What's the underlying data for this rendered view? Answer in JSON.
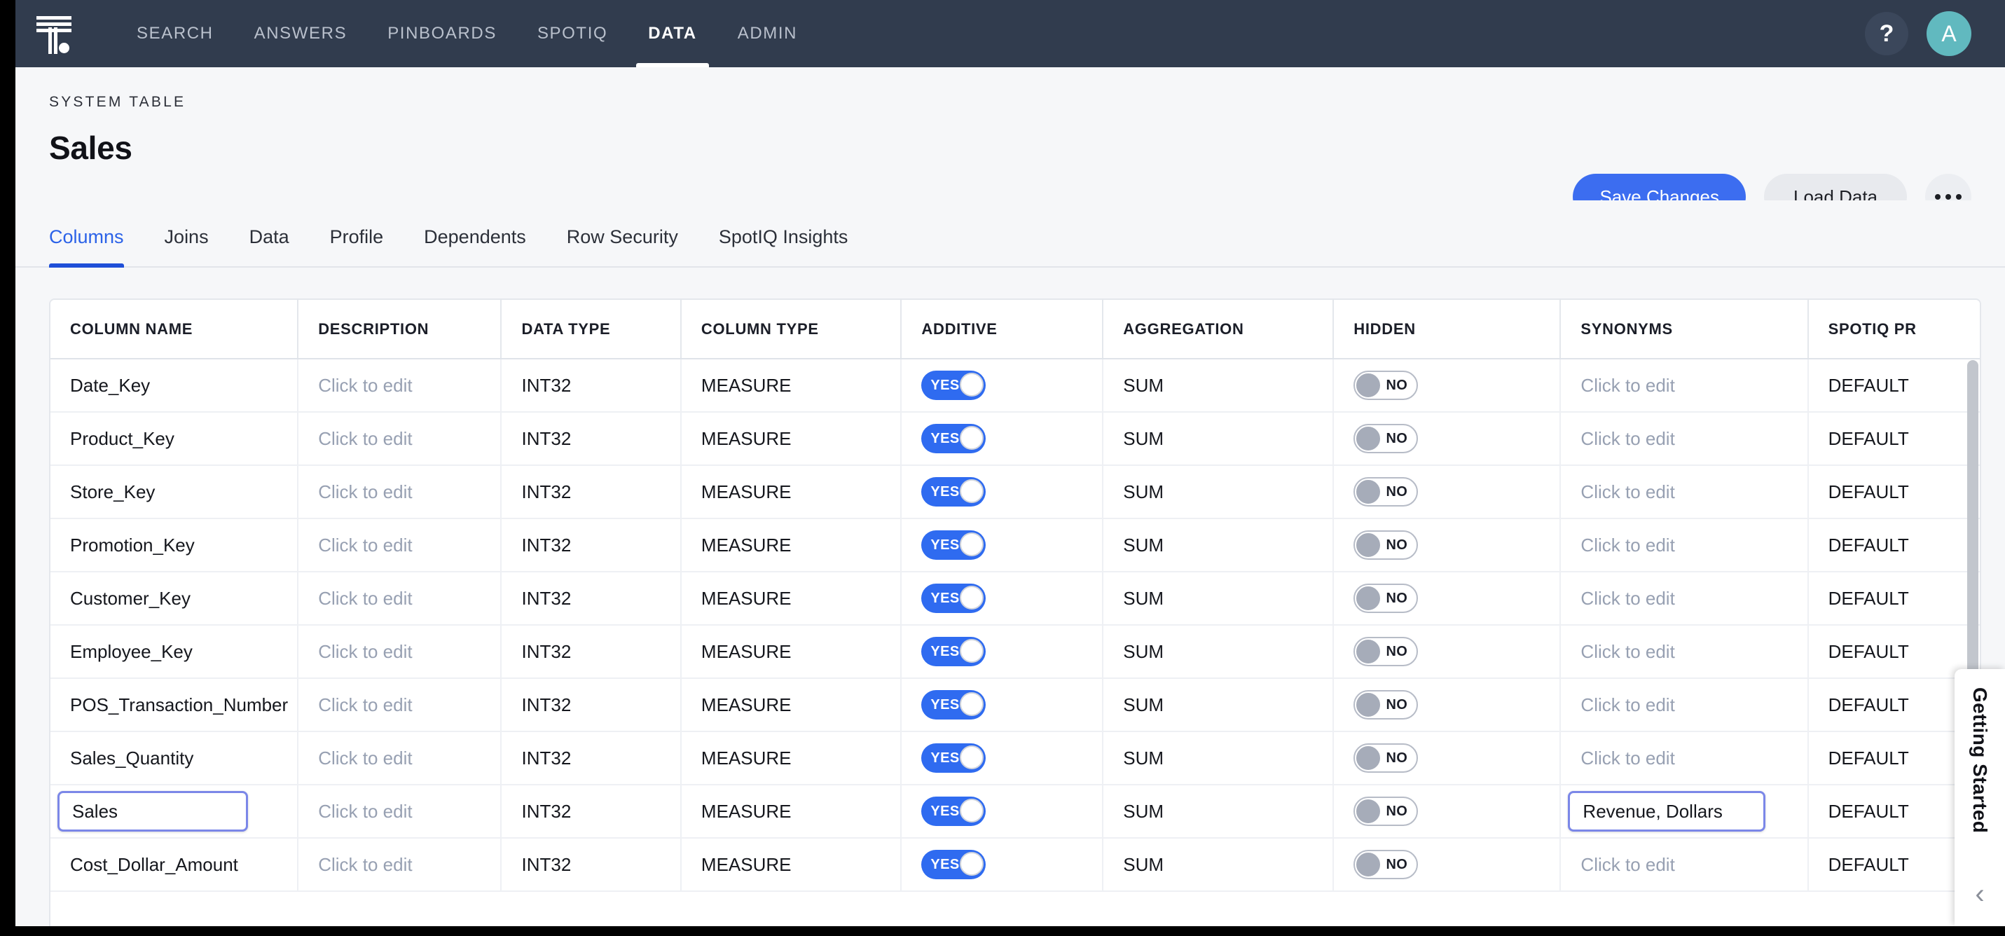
{
  "app": {
    "logo_icon": "thoughtspot-logo-icon",
    "nav_items": [
      {
        "label": "SEARCH",
        "active": false
      },
      {
        "label": "ANSWERS",
        "active": false
      },
      {
        "label": "PINBOARDS",
        "active": false
      },
      {
        "label": "SPOTIQ",
        "active": false
      },
      {
        "label": "DATA",
        "active": true
      },
      {
        "label": "ADMIN",
        "active": false
      }
    ],
    "help_glyph": "?",
    "help_icon": "help-question-icon",
    "avatar_initial": "A",
    "avatar_color": "#61b9bf",
    "nav_background": "#313c4e"
  },
  "page": {
    "eyebrow": "SYSTEM TABLE",
    "title": "Sales",
    "actions": {
      "save_label": "Save Changes",
      "load_label": "Load Data",
      "more_icon": "more-horizontal-icon"
    },
    "accent_color": "#3c6df0"
  },
  "tabs": [
    {
      "label": "Columns",
      "active": true
    },
    {
      "label": "Joins",
      "active": false
    },
    {
      "label": "Data",
      "active": false
    },
    {
      "label": "Profile",
      "active": false
    },
    {
      "label": "Dependents",
      "active": false
    },
    {
      "label": "Row Security",
      "active": false
    },
    {
      "label": "SpotIQ Insights",
      "active": false
    }
  ],
  "table": {
    "headers": [
      "COLUMN NAME",
      "DESCRIPTION",
      "DATA TYPE",
      "COLUMN TYPE",
      "ADDITIVE",
      "AGGREGATION",
      "HIDDEN",
      "SYNONYMS",
      "SPOTIQ PR"
    ],
    "description_placeholder": "Click to edit",
    "synonyms_placeholder": "Click to edit",
    "toggle_on_label": "YES",
    "toggle_off_label": "NO",
    "rows": [
      {
        "name": "Date_Key",
        "description": "Click to edit",
        "data_type": "INT32",
        "column_type": "MEASURE",
        "additive": "YES",
        "aggregation": "SUM",
        "hidden": "NO",
        "synonyms": "Click to edit",
        "spotiq": "DEFAULT",
        "name_editing": false,
        "synonyms_editing": false
      },
      {
        "name": "Product_Key",
        "description": "Click to edit",
        "data_type": "INT32",
        "column_type": "MEASURE",
        "additive": "YES",
        "aggregation": "SUM",
        "hidden": "NO",
        "synonyms": "Click to edit",
        "spotiq": "DEFAULT",
        "name_editing": false,
        "synonyms_editing": false
      },
      {
        "name": "Store_Key",
        "description": "Click to edit",
        "data_type": "INT32",
        "column_type": "MEASURE",
        "additive": "YES",
        "aggregation": "SUM",
        "hidden": "NO",
        "synonyms": "Click to edit",
        "spotiq": "DEFAULT",
        "name_editing": false,
        "synonyms_editing": false
      },
      {
        "name": "Promotion_Key",
        "description": "Click to edit",
        "data_type": "INT32",
        "column_type": "MEASURE",
        "additive": "YES",
        "aggregation": "SUM",
        "hidden": "NO",
        "synonyms": "Click to edit",
        "spotiq": "DEFAULT",
        "name_editing": false,
        "synonyms_editing": false
      },
      {
        "name": "Customer_Key",
        "description": "Click to edit",
        "data_type": "INT32",
        "column_type": "MEASURE",
        "additive": "YES",
        "aggregation": "SUM",
        "hidden": "NO",
        "synonyms": "Click to edit",
        "spotiq": "DEFAULT",
        "name_editing": false,
        "synonyms_editing": false
      },
      {
        "name": "Employee_Key",
        "description": "Click to edit",
        "data_type": "INT32",
        "column_type": "MEASURE",
        "additive": "YES",
        "aggregation": "SUM",
        "hidden": "NO",
        "synonyms": "Click to edit",
        "spotiq": "DEFAULT",
        "name_editing": false,
        "synonyms_editing": false
      },
      {
        "name": "POS_Transaction_Number",
        "description": "Click to edit",
        "data_type": "INT32",
        "column_type": "MEASURE",
        "additive": "YES",
        "aggregation": "SUM",
        "hidden": "NO",
        "synonyms": "Click to edit",
        "spotiq": "DEFAULT",
        "name_editing": false,
        "synonyms_editing": false
      },
      {
        "name": "Sales_Quantity",
        "description": "Click to edit",
        "data_type": "INT32",
        "column_type": "MEASURE",
        "additive": "YES",
        "aggregation": "SUM",
        "hidden": "NO",
        "synonyms": "Click to edit",
        "spotiq": "DEFAULT",
        "name_editing": false,
        "synonyms_editing": false
      },
      {
        "name": "Sales",
        "description": "Click to edit",
        "data_type": "INT32",
        "column_type": "MEASURE",
        "additive": "YES",
        "aggregation": "SUM",
        "hidden": "NO",
        "synonyms": "Revenue, Dollars",
        "spotiq": "DEFAULT",
        "name_editing": true,
        "synonyms_editing": true
      },
      {
        "name": "Cost_Dollar_Amount",
        "description": "Click to edit",
        "data_type": "INT32",
        "column_type": "MEASURE",
        "additive": "YES",
        "aggregation": "SUM",
        "hidden": "NO",
        "synonyms": "Click to edit",
        "spotiq": "DEFAULT",
        "name_editing": false,
        "synonyms_editing": false
      }
    ]
  },
  "side_panel": {
    "label": "Getting Started",
    "collapse_icon": "chevron-left-icon",
    "collapse_glyph": "‹"
  }
}
